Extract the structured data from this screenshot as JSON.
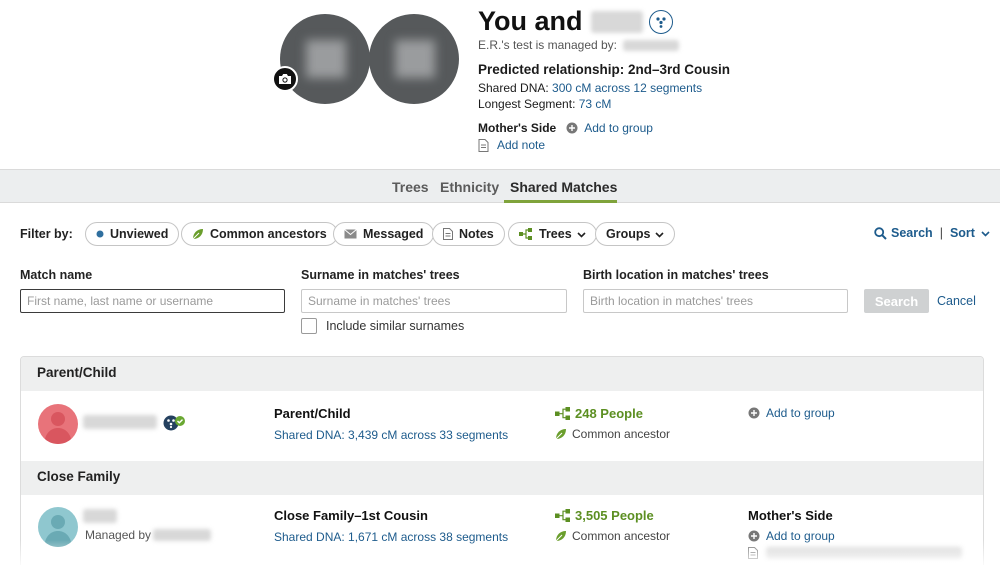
{
  "header": {
    "title_prefix": "You and",
    "managed_by": "E.R.'s test is managed by:",
    "predicted_relationship": "Predicted relationship: 2nd–3rd Cousin",
    "shared_dna_label": "Shared DNA:",
    "shared_dna_value": "300 cM across 12 segments",
    "longest_segment_label": "Longest Segment:",
    "longest_segment_value": "73 cM",
    "side": "Mother's Side",
    "add_to_group": "Add to group",
    "add_note": "Add note"
  },
  "tabs": [
    {
      "label": "Trees"
    },
    {
      "label": "Ethnicity"
    },
    {
      "label": "Shared Matches",
      "active": true
    }
  ],
  "filters": {
    "label": "Filter by:",
    "chips": [
      "Unviewed",
      "Common ancestors",
      "Messaged",
      "Notes",
      "Trees",
      "Groups"
    ],
    "search_link": "Search",
    "sort_link": "Sort"
  },
  "search_form": {
    "match_name_label": "Match name",
    "match_name_placeholder": "First name, last name or username",
    "surname_label": "Surname in matches' trees",
    "surname_placeholder": "Surname in matches' trees",
    "birth_label": "Birth location in matches' trees",
    "birth_placeholder": "Birth location in matches' trees",
    "search_button": "Search",
    "cancel": "Cancel",
    "similar_surnames": "Include similar surnames"
  },
  "groups": [
    {
      "title": "Parent/Child",
      "match": {
        "relationship": "Parent/Child",
        "shared_dna": "Shared DNA: 3,439 cM across 33 segments",
        "people": "248 People",
        "common_ancestor": "Common ancestor",
        "add_to_group": "Add to group",
        "avatar_color": "#e8737a"
      }
    },
    {
      "title": "Close Family",
      "match": {
        "managed_by": "Managed by",
        "relationship": "Close Family–1st Cousin",
        "shared_dna": "Shared DNA: 1,671 cM across 38 segments",
        "people": "3,505 People",
        "common_ancestor": "Common ancestor",
        "side": "Mother's Side",
        "add_to_group": "Add to group",
        "avatar_color": "#8fc7cf"
      }
    }
  ],
  "colors": {
    "link": "#1d5b8c",
    "green": "#5c8f22",
    "tab_underline": "#7fa33b",
    "unviewed_dot": "#2f6f9f"
  }
}
